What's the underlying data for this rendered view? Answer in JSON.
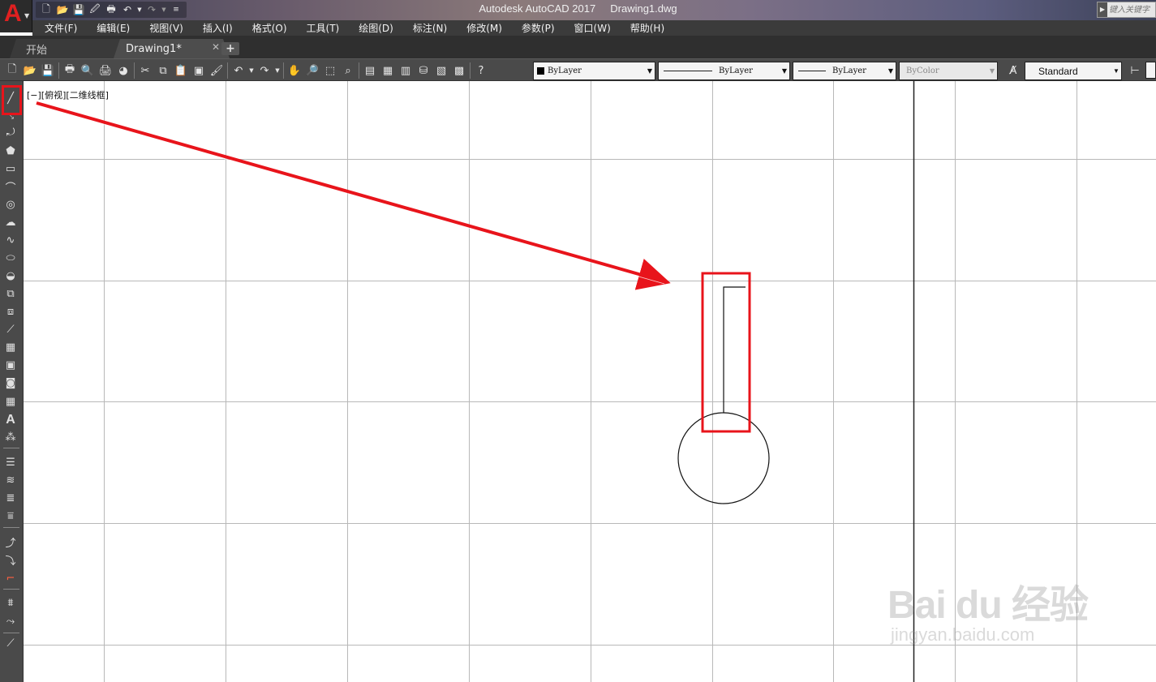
{
  "window": {
    "app_title": "Autodesk AutoCAD 2017",
    "file_name": "Drawing1.dwg",
    "search_placeholder": "键入关键字",
    "logo_letter": "A"
  },
  "menu": [
    {
      "label": "文件(F)"
    },
    {
      "label": "编辑(E)"
    },
    {
      "label": "视图(V)"
    },
    {
      "label": "插入(I)"
    },
    {
      "label": "格式(O)"
    },
    {
      "label": "工具(T)"
    },
    {
      "label": "绘图(D)"
    },
    {
      "label": "标注(N)"
    },
    {
      "label": "修改(M)"
    },
    {
      "label": "参数(P)"
    },
    {
      "label": "窗口(W)"
    },
    {
      "label": "帮助(H)"
    }
  ],
  "tabs": {
    "start": "开始",
    "drawing": "Drawing1*",
    "close_glyph": "✕",
    "new_glyph": "+"
  },
  "properties": {
    "color": "ByLayer",
    "linetype": "ByLayer",
    "lineweight": "ByLayer",
    "plotstyle": "ByColor",
    "text_style": "Standard"
  },
  "canvas": {
    "viewport_label": "[−][俯视][二维线框]"
  },
  "watermark": {
    "main": "Bai du 经验",
    "sub": "jingyan.baidu.com"
  },
  "colors": {
    "highlight": "#e8141b",
    "grid": "#b8b8b8",
    "ui_dark": "#4a4a4a"
  }
}
